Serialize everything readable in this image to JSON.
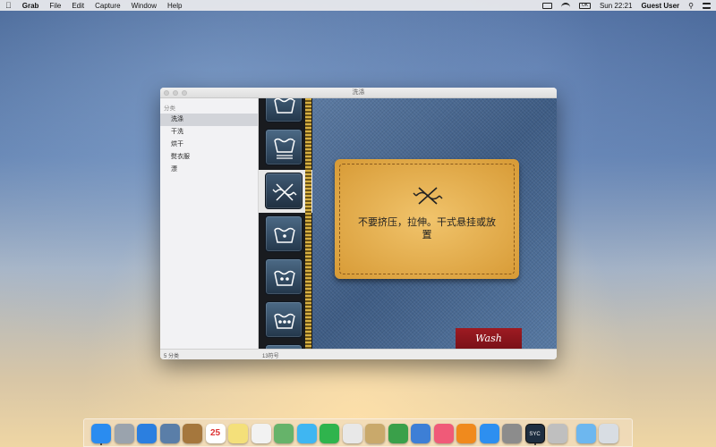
{
  "menubar": {
    "apple": "",
    "app": "Grab",
    "menus": [
      "File",
      "Edit",
      "Capture",
      "Window",
      "Help"
    ],
    "clock": "Sun 22:21",
    "user": "Guest User",
    "battery_label": "OK"
  },
  "window": {
    "title": "洗涤",
    "sidebar": {
      "section": "分类",
      "items": [
        "洗涤",
        "干洗",
        "烘干",
        "熨衣服",
        "漂"
      ]
    },
    "status_left": "5 分类",
    "status_right": "13符号",
    "detail": {
      "text": "不要挤压，拉伸。干式悬挂或放置",
      "tag": "Wash"
    }
  },
  "dock": {
    "calendar_day": "25",
    "selected_icon_label": "SYC",
    "icons": [
      {
        "name": "finder-icon",
        "color": "#2a8cf0"
      },
      {
        "name": "launchpad-icon",
        "color": "#9aa3ad"
      },
      {
        "name": "safari-icon",
        "color": "#2b7fe0"
      },
      {
        "name": "photo-icon",
        "color": "#5a7ea8"
      },
      {
        "name": "contacts-icon",
        "color": "#a5773d"
      },
      {
        "name": "calendar-icon",
        "color": "#ffffff"
      },
      {
        "name": "notes-icon",
        "color": "#f4e07a"
      },
      {
        "name": "reminders-icon",
        "color": "#f2f2f2"
      },
      {
        "name": "maps-icon",
        "color": "#66b36a"
      },
      {
        "name": "messages-icon",
        "color": "#3fb6f2"
      },
      {
        "name": "facetime-icon",
        "color": "#2fb44d"
      },
      {
        "name": "photos-app-icon",
        "color": "#e8e8e8"
      },
      {
        "name": "preview-icon",
        "color": "#c9a96b"
      },
      {
        "name": "numbers-icon",
        "color": "#3aa04a"
      },
      {
        "name": "keynote-icon",
        "color": "#3d7fd6"
      },
      {
        "name": "itunes-icon",
        "color": "#f05a78"
      },
      {
        "name": "ibooks-icon",
        "color": "#f08a1d"
      },
      {
        "name": "app-store-icon",
        "color": "#2d8ff0"
      },
      {
        "name": "system-preferences-icon",
        "color": "#8c8c8c"
      },
      {
        "name": "laundry-symbols-app-icon",
        "color": "#1e2e40"
      },
      {
        "name": "grab-icon",
        "color": "#bfbfbf"
      },
      {
        "name": "downloads-folder-icon",
        "color": "#6db7ef"
      },
      {
        "name": "trash-icon",
        "color": "#d8dde3"
      }
    ]
  }
}
